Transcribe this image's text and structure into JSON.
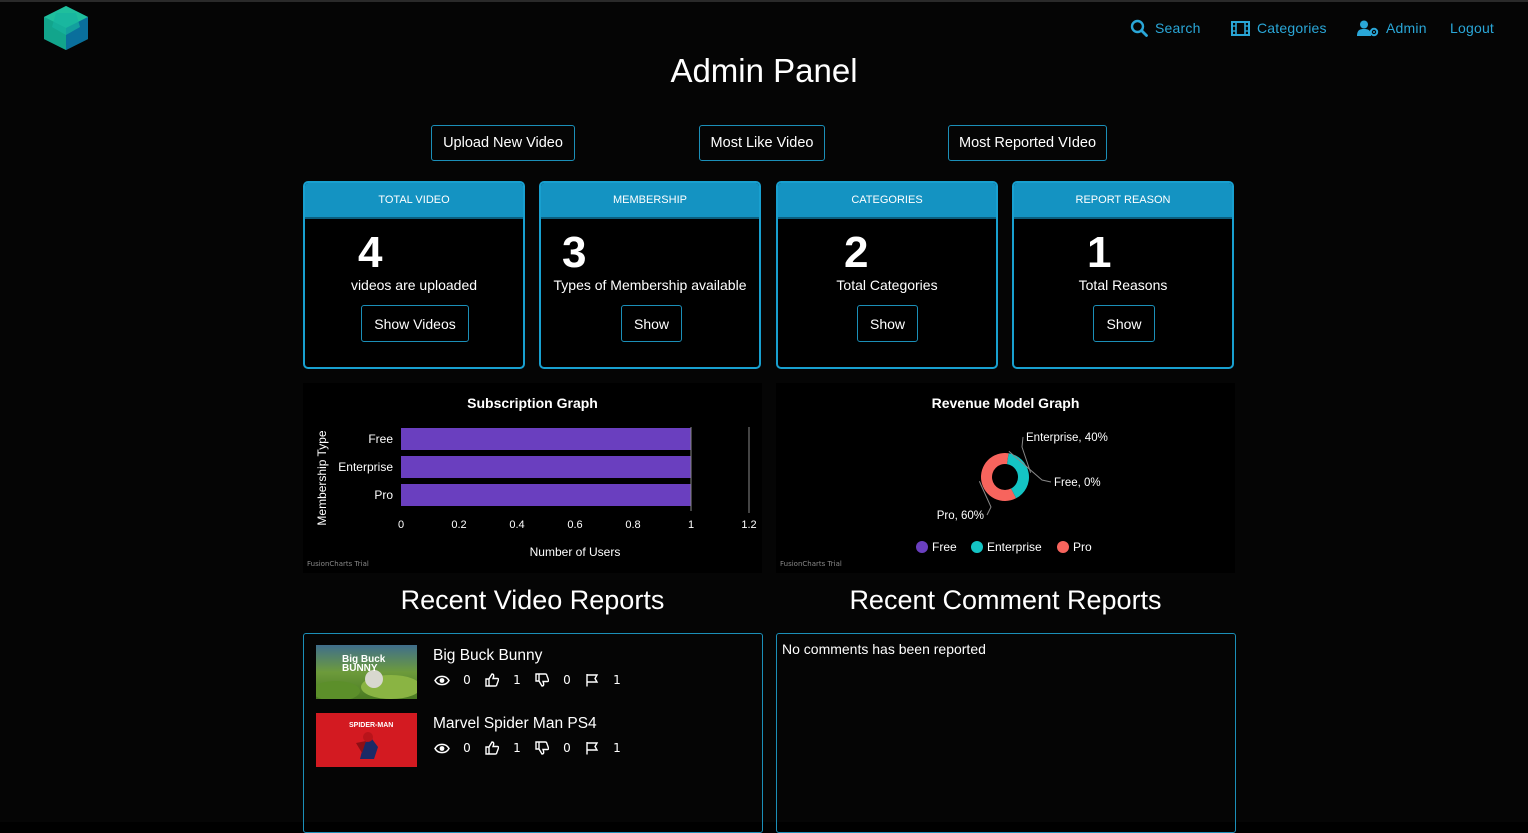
{
  "nav": {
    "search": "Search",
    "categories": "Categories",
    "admin": "Admin",
    "logout": "Logout",
    "link_color": "#2aa7d8"
  },
  "page_title": "Admin Panel",
  "actions": {
    "upload": "Upload New Video",
    "most_liked": "Most Like Video",
    "most_reported": "Most Reported VIdeo"
  },
  "cards": [
    {
      "heading": "TOTAL VIDEO",
      "count": "4",
      "description": "videos are uploaded",
      "button": "Show Videos"
    },
    {
      "heading": "MEMBERSHIP",
      "count": "3",
      "description": "Types of Membership available",
      "button": "Show"
    },
    {
      "heading": "CATEGORIES",
      "count": "2",
      "description": "Total Categories",
      "button": "Show"
    },
    {
      "heading": "REPORT REASON",
      "count": "1",
      "description": "Total Reasons",
      "button": "Show"
    }
  ],
  "chart_data": [
    {
      "type": "bar",
      "orientation": "horizontal",
      "title": "Subscription Graph",
      "xlabel": "Number of Users",
      "ylabel": "Membership Type",
      "categories": [
        "Free",
        "Enterprise",
        "Pro"
      ],
      "values": [
        1,
        1,
        1
      ],
      "xlim": [
        0,
        1.2
      ],
      "ticks": [
        "0",
        "0.2",
        "0.4",
        "0.6",
        "0.8",
        "1",
        "1.2"
      ],
      "color": "#6a3fbf",
      "watermark": "FusionCharts Trial"
    },
    {
      "type": "pie",
      "variant": "doughnut",
      "title": "Revenue Model Graph",
      "categories": [
        "Free",
        "Enterprise",
        "Pro"
      ],
      "values": [
        0,
        40,
        60
      ],
      "labels": [
        "Free, 0%",
        "Enterprise, 40%",
        "Pro, 60%"
      ],
      "colors": [
        "#6a3fbf",
        "#14c4c4",
        "#f7645d"
      ],
      "legend": "bottom",
      "watermark": "FusionCharts Trial"
    }
  ],
  "sections": {
    "video_reports": "Recent Video Reports",
    "comment_reports": "Recent Comment Reports"
  },
  "video_reports": [
    {
      "title": "Big Buck Bunny",
      "thumb_text": "Big Buck BUNNY",
      "views": "0",
      "likes": "1",
      "dislikes": "0",
      "reports": "1"
    },
    {
      "title": "Marvel Spider Man PS4",
      "thumb_text": "SPIDER-MAN",
      "views": "0",
      "likes": "1",
      "dislikes": "0",
      "reports": "1"
    }
  ],
  "comment_reports_empty": "No comments has been reported"
}
